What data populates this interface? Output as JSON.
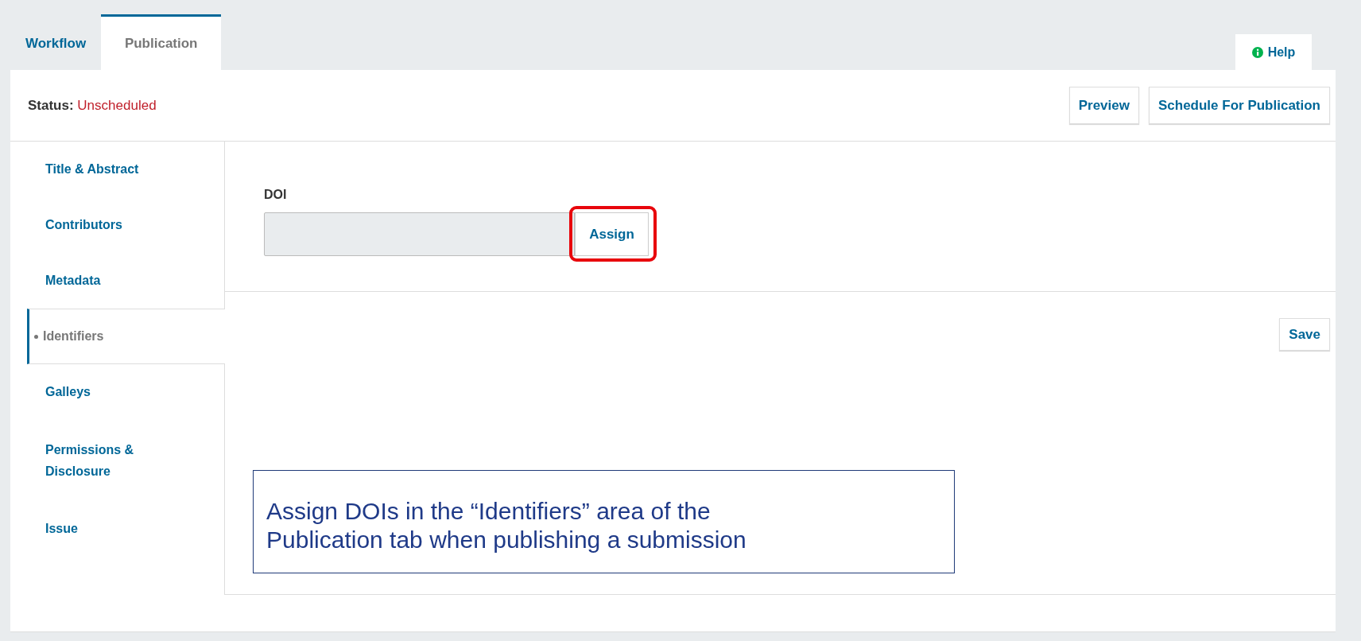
{
  "tabs": [
    {
      "label": "Workflow",
      "selected": false
    },
    {
      "label": "Publication",
      "selected": true
    }
  ],
  "help": {
    "label": "Help"
  },
  "status": {
    "label": "Status:",
    "value": "Unscheduled"
  },
  "header_buttons": [
    "Preview",
    "Schedule For Publication"
  ],
  "sidebar": {
    "items": [
      {
        "label": "Title & Abstract",
        "selected": false
      },
      {
        "label": "Contributors",
        "selected": false
      },
      {
        "label": "Metadata",
        "selected": false
      },
      {
        "label": "Identifiers",
        "selected": true
      },
      {
        "label": "Galleys",
        "selected": false
      },
      {
        "label": "Permissions & Disclosure",
        "selected": false
      },
      {
        "label": "Issue",
        "selected": false
      }
    ]
  },
  "doi": {
    "label": "DOI",
    "button": "Assign",
    "highlighted": true
  },
  "save_button": "Save",
  "callout": {
    "lines": [
      "Assign DOIs in the “Identifiers” area of the",
      "Publication tab when publishing a submission"
    ]
  }
}
